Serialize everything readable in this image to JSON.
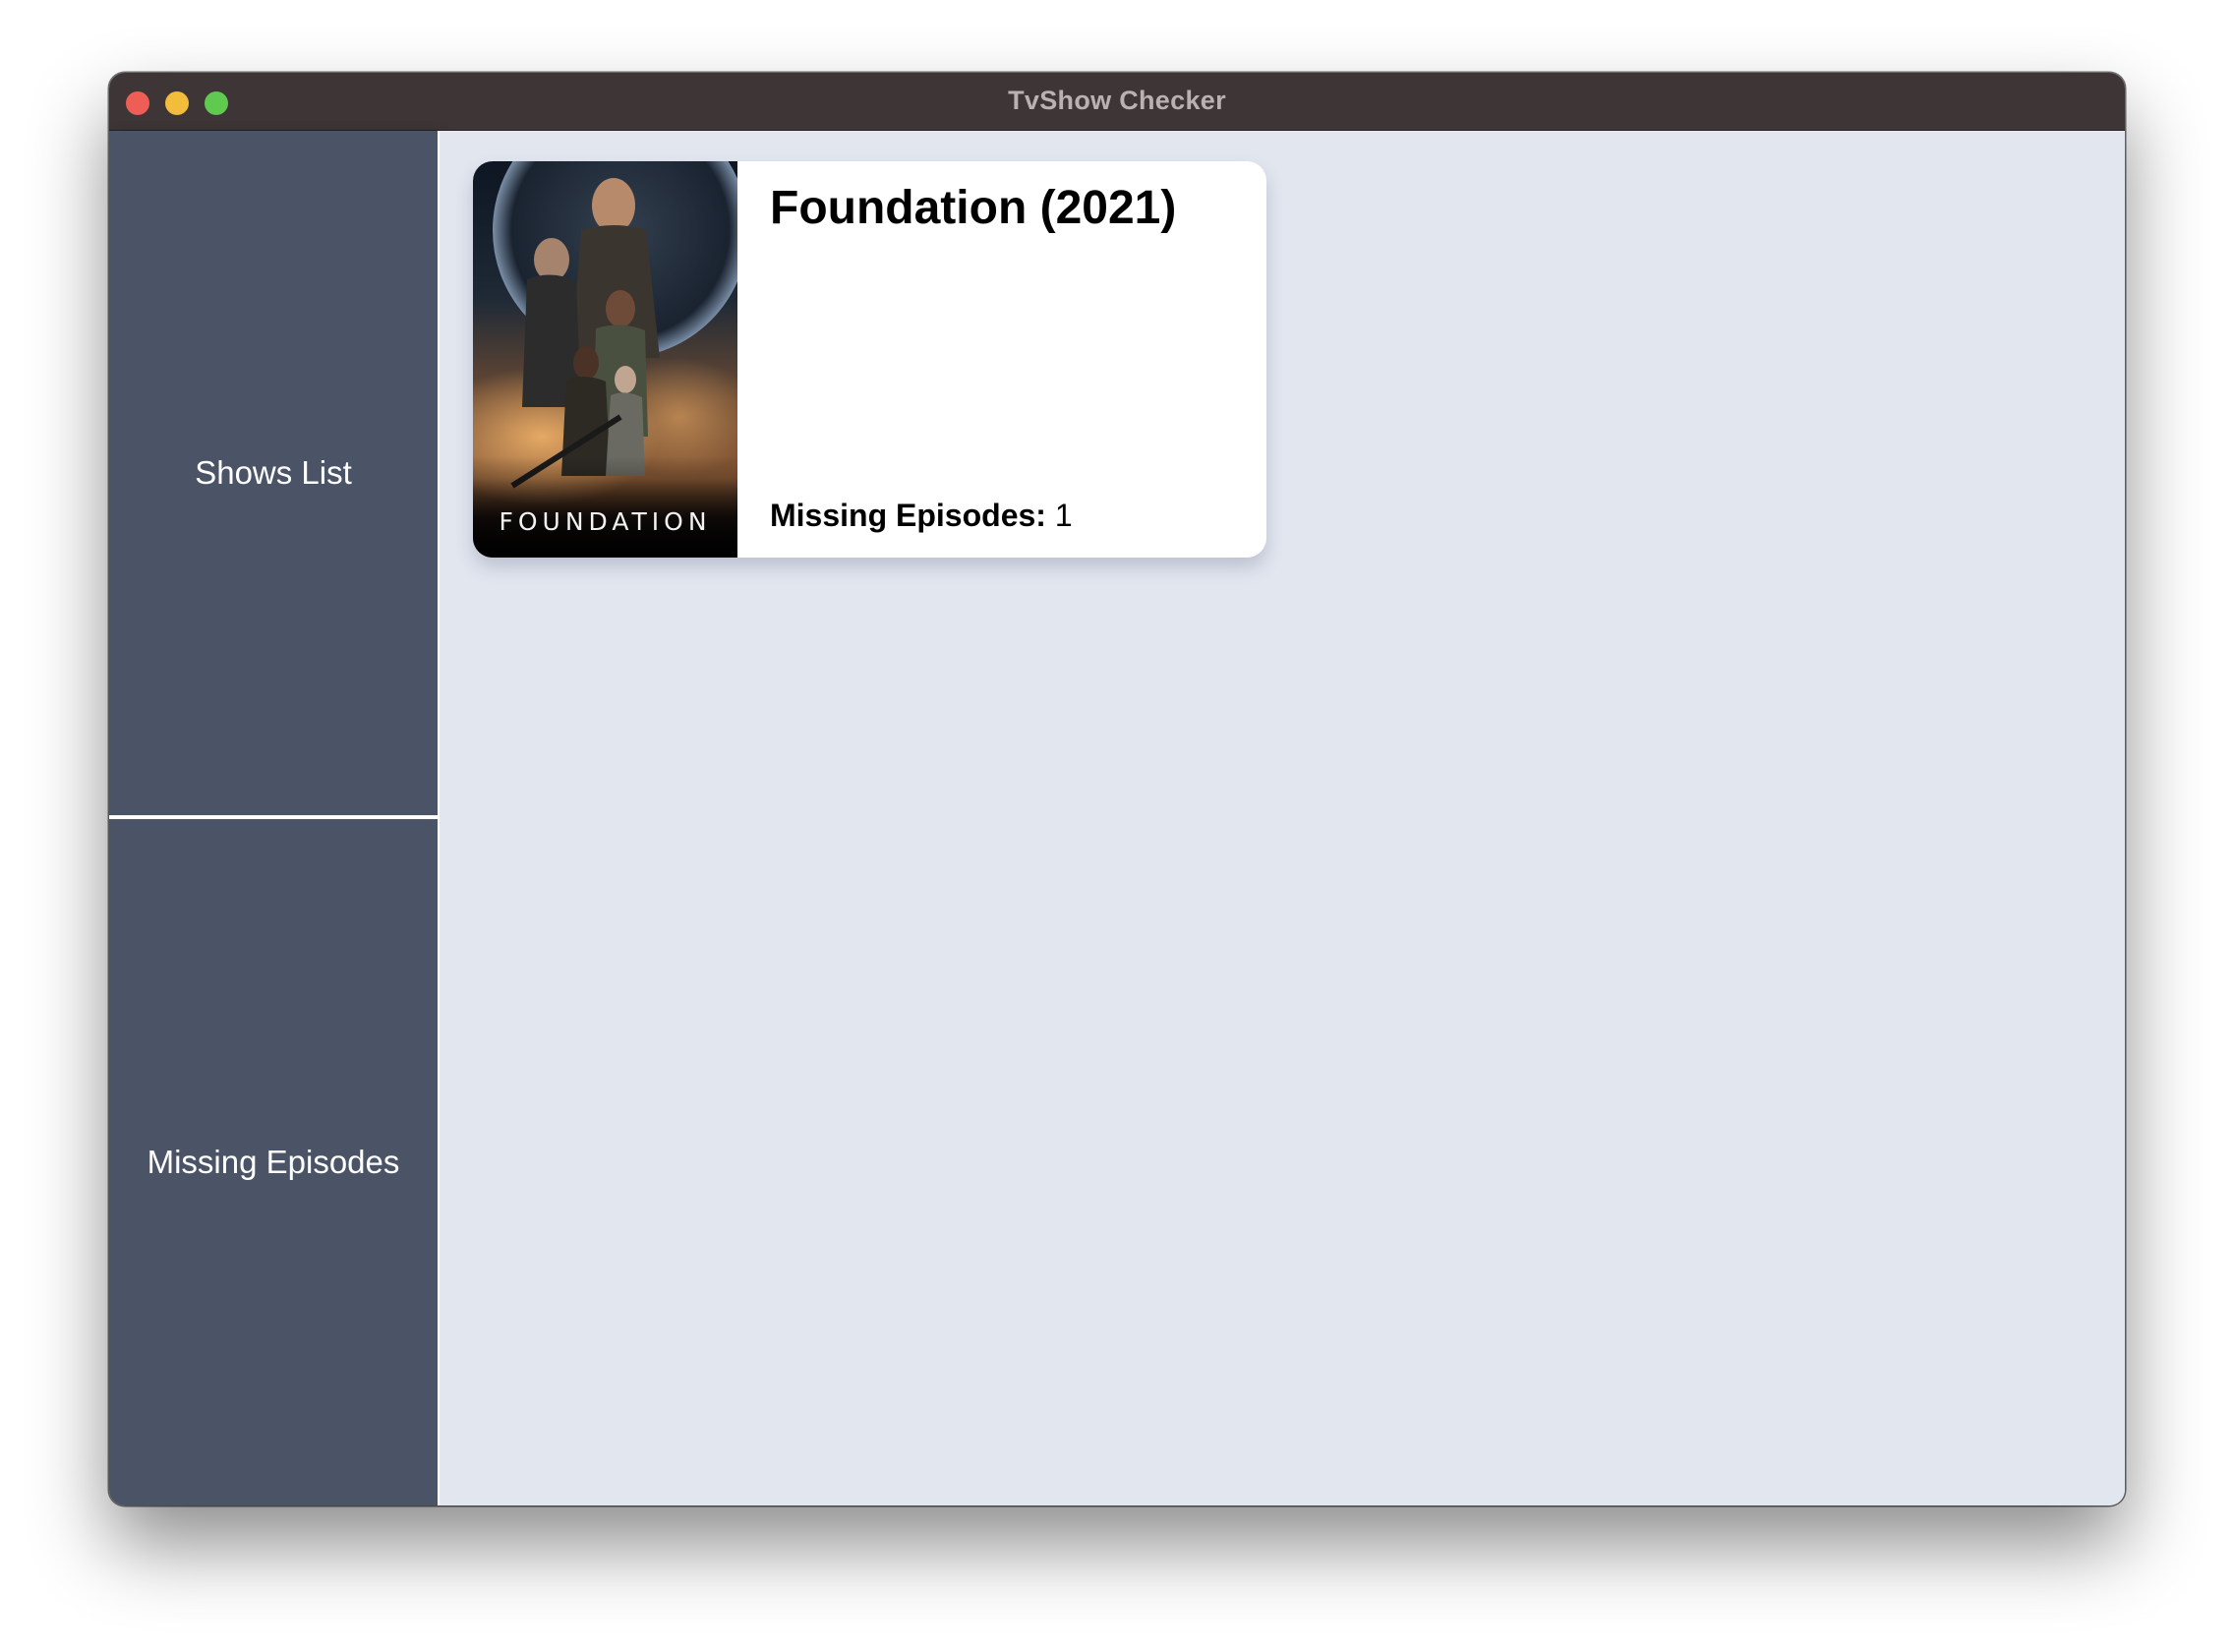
{
  "window": {
    "title": "TvShow Checker"
  },
  "sidebar": {
    "items": [
      {
        "label": "Shows List"
      },
      {
        "label": "Missing Episodes"
      }
    ]
  },
  "shows": [
    {
      "title": "Foundation (2021)",
      "poster_text": "FOUNDATION",
      "missing_label": "Missing Episodes:",
      "missing_count": "1"
    }
  ],
  "colors": {
    "titlebar": "#3e3536",
    "sidebar": "#4a5466",
    "content_background": "#e2e6ef",
    "card": "#ffffff",
    "traffic_close": "#ee5e56",
    "traffic_minimize": "#f2bd3b",
    "traffic_maximize": "#5fc950"
  }
}
